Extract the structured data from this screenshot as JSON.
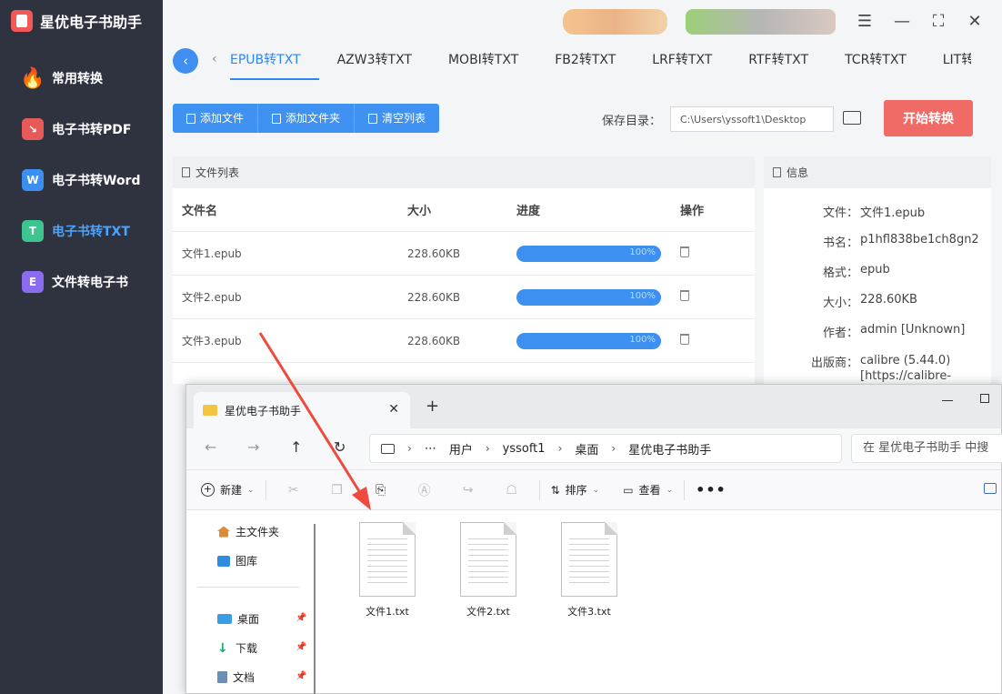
{
  "app": {
    "title": "星优电子书助手",
    "nav": [
      {
        "label": "常用转换",
        "icon": "fire-icon"
      },
      {
        "label": "电子书转PDF",
        "icon": "pdf-icon"
      },
      {
        "label": "电子书转Word",
        "icon": "word-icon",
        "glyph": "W"
      },
      {
        "label": "电子书转TXT",
        "icon": "txt-icon",
        "glyph": "T",
        "active": true
      },
      {
        "label": "文件转电子书",
        "icon": "ebook-icon",
        "glyph": "E"
      }
    ],
    "accent": "#2e86f0",
    "sidebar_bg": "#2f3340"
  },
  "tabs": [
    "EPUB转TXT",
    "AZW3转TXT",
    "MOBI转TXT",
    "FB2转TXT",
    "LRF转TXT",
    "RTF转TXT",
    "TCR转TXT",
    "LIT转TX"
  ],
  "toolbar": {
    "add_file": "添加文件",
    "add_folder": "添加文件夹",
    "clear_list": "清空列表",
    "save_label": "保存目录：",
    "save_path": "C:\\Users\\yssoft1\\Desktop",
    "start": "开始转换"
  },
  "file_list": {
    "title": "文件列表",
    "columns": [
      "文件名",
      "大小",
      "进度",
      "操作"
    ],
    "rows": [
      {
        "name": "文件1.epub",
        "size": "228.60KB",
        "progress": "100%"
      },
      {
        "name": "文件2.epub",
        "size": "228.60KB",
        "progress": "100%"
      },
      {
        "name": "文件3.epub",
        "size": "228.60KB",
        "progress": "100%"
      }
    ]
  },
  "info": {
    "title": "信息",
    "rows": [
      {
        "k": "文件：",
        "v": "文件1.epub"
      },
      {
        "k": "书名：",
        "v": "p1hfl838be1ch8gn2"
      },
      {
        "k": "格式：",
        "v": "epub"
      },
      {
        "k": "大小：",
        "v": "228.60KB"
      },
      {
        "k": "作者：",
        "v": "admin [Unknown]"
      },
      {
        "k": "出版商：",
        "v": "calibre (5.44.0) [https://calibre-"
      }
    ]
  },
  "explorer": {
    "tab_title": "星优电子书助手",
    "breadcrumb": [
      "用户",
      "yssoft1",
      "桌面",
      "星优电子书助手"
    ],
    "search_placeholder": "在 星优电子书助手 中搜",
    "commands": {
      "new": "新建",
      "sort": "排序",
      "view": "查看"
    },
    "nav_pane": [
      {
        "label": "主文件夹",
        "icon": "home-icon"
      },
      {
        "label": "图库",
        "icon": "gallery-icon"
      },
      {
        "label": "桌面",
        "icon": "desktop-icon",
        "pinned": true
      },
      {
        "label": "下载",
        "icon": "download-icon",
        "pinned": true
      },
      {
        "label": "文档",
        "icon": "documents-icon",
        "pinned": true
      }
    ],
    "files": [
      "文件1.txt",
      "文件2.txt",
      "文件3.txt"
    ]
  }
}
